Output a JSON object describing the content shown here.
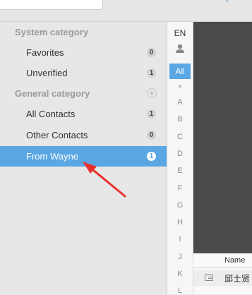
{
  "toolbar": {
    "add_icon": "plus-icon"
  },
  "sidebar": {
    "system_header": "System category",
    "favorites": {
      "label": "Favorites",
      "count": "0"
    },
    "unverified": {
      "label": "Unverified",
      "count": "1"
    },
    "general_header": "General category",
    "all_contacts": {
      "label": "All Contacts",
      "count": "1"
    },
    "other_contacts": {
      "label": "Other Contacts",
      "count": "0"
    },
    "from_wayne": {
      "label": "From Wayne",
      "count": "1"
    }
  },
  "index": {
    "lang": "EN",
    "all": "All",
    "letters": [
      "A",
      "B",
      "C",
      "D",
      "E",
      "F",
      "G",
      "H",
      "I",
      "J",
      "K",
      "L"
    ]
  },
  "table": {
    "name_header": "Name",
    "rows": [
      {
        "name": "邱士贤"
      }
    ]
  },
  "colors": {
    "accent": "#5aa7e3",
    "annotation_arrow": "#e8312f"
  }
}
